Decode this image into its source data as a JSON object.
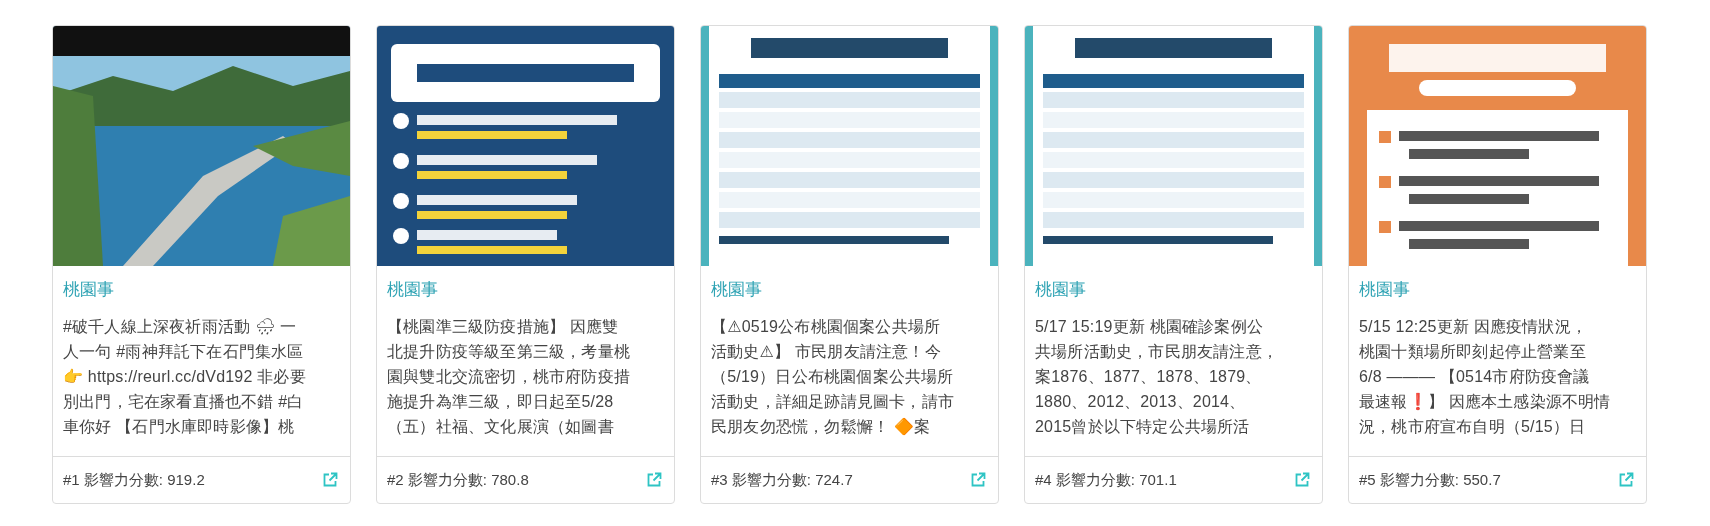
{
  "cards": [
    {
      "source": "桃園事",
      "lines": [
        "#破千人線上深夜祈雨活動 🌧 一",
        "人一句 #雨神拜託下在石門集水區",
        "👉 https://reurl.cc/dVd192 非必要",
        "別出門，宅在家看直播也不錯 #白",
        "車你好 【石門水庫即時影像】桃"
      ],
      "score": "#1 影響力分數: 919.2"
    },
    {
      "source": "桃園事",
      "lines": [
        "【桃園準三級防疫措施】 因應雙",
        "北提升防疫等級至第三級，考量桃",
        "園與雙北交流密切，桃市府防疫措",
        "施提升為準三級，即日起至5/28",
        "（五）社福、文化展演（如圖書"
      ],
      "score": "#2 影響力分數: 780.8"
    },
    {
      "source": "桃園事",
      "lines": [
        "【⚠0519公布桃園個案公共場所",
        "活動史⚠】 市民朋友請注意！今",
        "（5/19）日公布桃園個案公共場所",
        "活動史，詳細足跡請見圖卡，請市",
        "民朋友勿恐慌，勿鬆懈！ 🔶案"
      ],
      "score": "#3 影響力分數: 724.7"
    },
    {
      "source": "桃園事",
      "lines": [
        "5/17 15:19更新 桃園確診案例公",
        "共場所活動史，市民朋友請注意，",
        "案1876、1877、1878、1879、",
        "1880、2012、2013、2014、",
        "2015曾於以下特定公共場所活"
      ],
      "score": "#4 影響力分數: 701.1"
    },
    {
      "source": "桃園事",
      "lines": [
        "5/15 12:25更新 因應疫情狀況，",
        "桃園十類場所即刻起停止營業至",
        "6/8 ——— 【0514市府防疫會議",
        "最速報❗】 因應本土感染源不明情",
        "況，桃市府宣布自明（5/15）日"
      ],
      "score": "#5 影響力分數: 550.7"
    }
  ]
}
